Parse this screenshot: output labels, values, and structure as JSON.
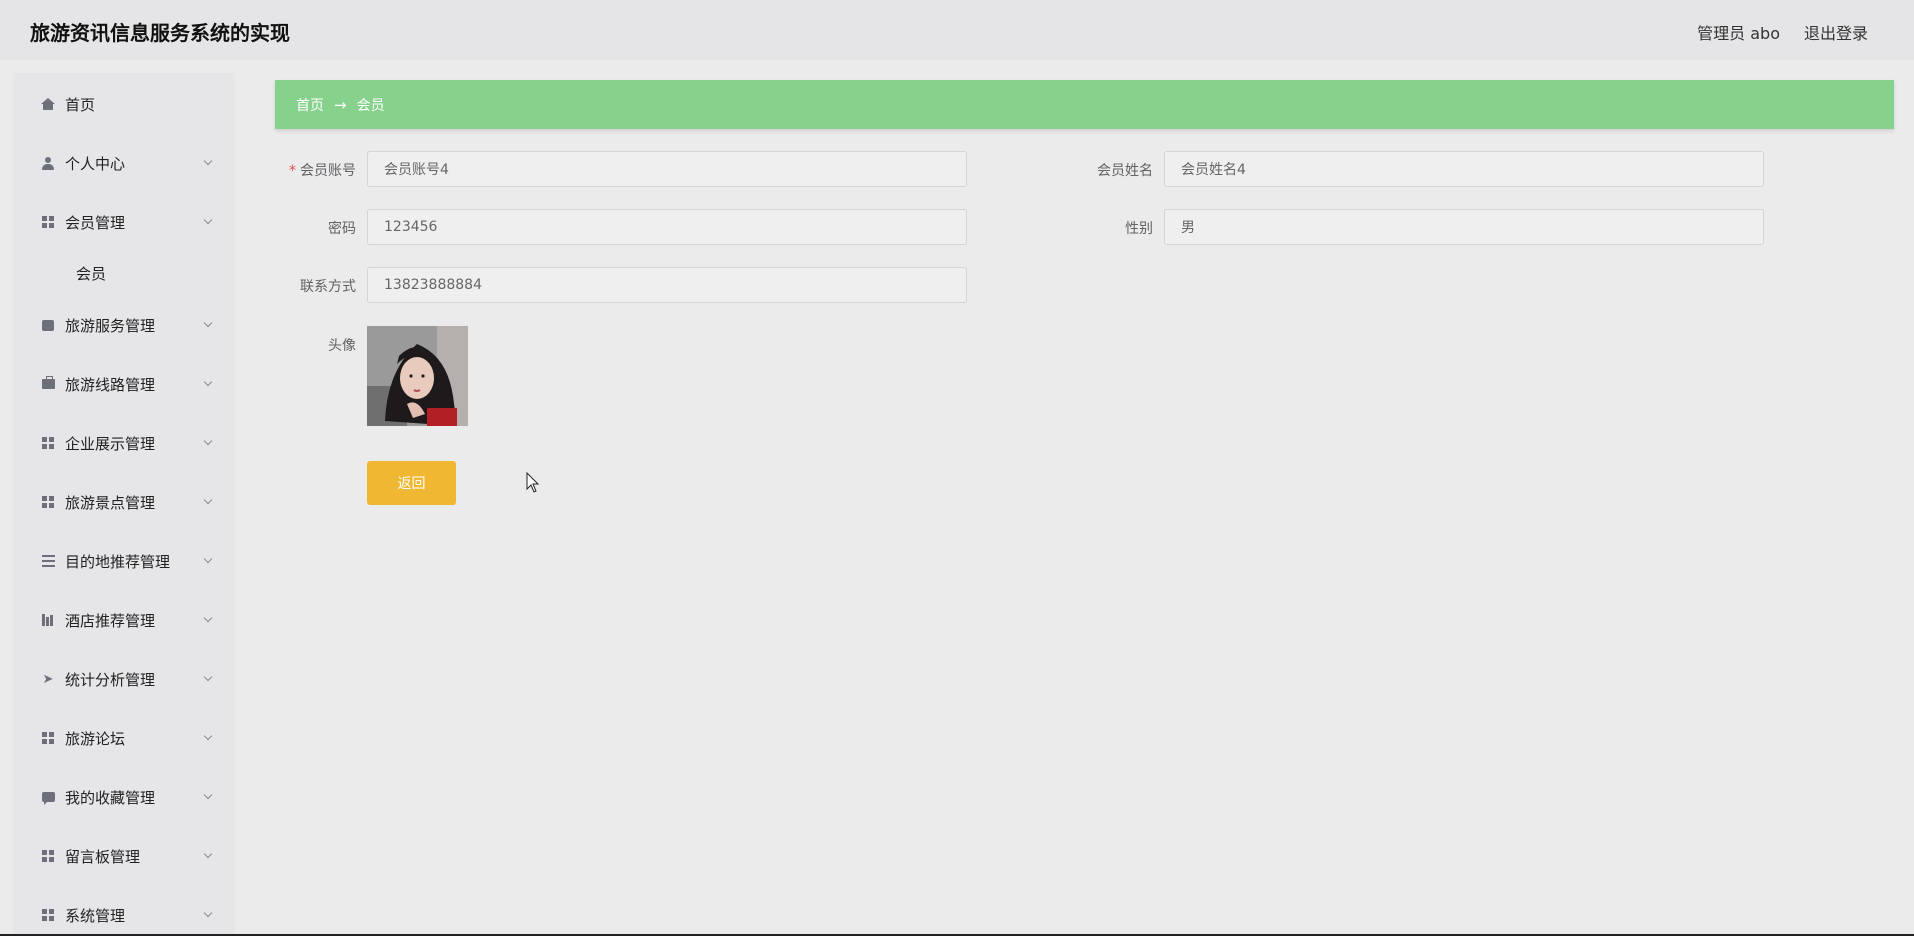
{
  "header": {
    "app_title": "旅游资讯信息服务系统的实现",
    "user_label": "管理员 abo",
    "logout_label": "退出登录"
  },
  "sidebar": {
    "items": [
      {
        "label": "首页",
        "icon": "home-icon"
      },
      {
        "label": "个人中心",
        "icon": "user-icon"
      },
      {
        "label": "会员管理",
        "icon": "grid-icon",
        "children": [
          {
            "label": "会员"
          }
        ]
      },
      {
        "label": "旅游服务管理",
        "icon": "box-icon"
      },
      {
        "label": "旅游线路管理",
        "icon": "briefcase-icon"
      },
      {
        "label": "企业展示管理",
        "icon": "grid-icon"
      },
      {
        "label": "旅游景点管理",
        "icon": "grid-icon"
      },
      {
        "label": "目的地推荐管理",
        "icon": "sliders-icon"
      },
      {
        "label": "酒店推荐管理",
        "icon": "bar-chart-icon"
      },
      {
        "label": "统计分析管理",
        "icon": "send-icon"
      },
      {
        "label": "旅游论坛",
        "icon": "grid-icon"
      },
      {
        "label": "我的收藏管理",
        "icon": "chat-icon"
      },
      {
        "label": "留言板管理",
        "icon": "grid-icon"
      },
      {
        "label": "系统管理",
        "icon": "grid-icon"
      }
    ]
  },
  "breadcrumb": {
    "home": "首页",
    "separator": "→",
    "current": "会员"
  },
  "form": {
    "account_label": "会员账号",
    "account_value": "会员账号4",
    "name_label": "会员姓名",
    "name_value": "会员姓名4",
    "password_label": "密码",
    "password_value": "123456",
    "gender_label": "性别",
    "gender_value": "男",
    "contact_label": "联系方式",
    "contact_value": "13823888884",
    "avatar_label": "头像",
    "required_mark": "*",
    "back_button": "返回"
  },
  "colors": {
    "breadcrumb_bg": "#86d18b",
    "back_button_bg": "#f0b832",
    "required": "#e24c4c"
  }
}
